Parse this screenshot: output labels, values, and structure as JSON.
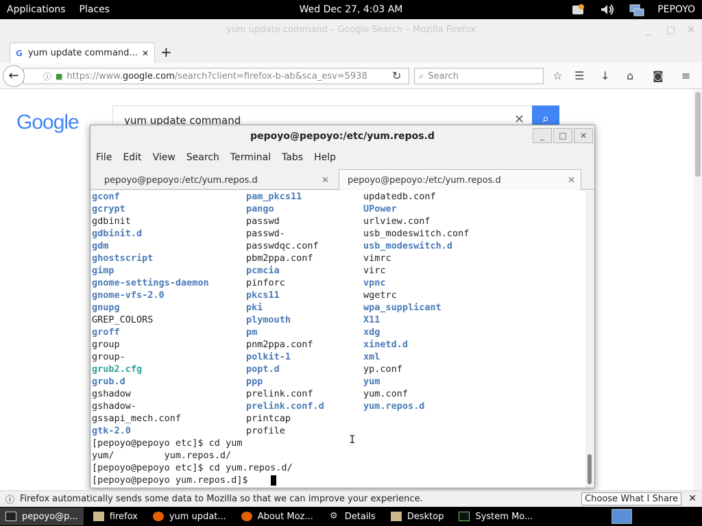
{
  "topbar": {
    "applications": "Applications",
    "places": "Places",
    "clock": "Wed Dec 27,  4:03 AM",
    "user": "PEPOYO"
  },
  "firefox": {
    "window_title": "yum update command – Google Search – Mozilla Firefox",
    "tab_title": "yum update command...",
    "url_prefix": "https://www.",
    "url_domain": "google.com",
    "url_rest": "/search?client=firefox-b-ab&sca_esv=5938",
    "search_placeholder": "Search",
    "notification": "Firefox automatically sends some data to Mozilla so that we can improve your experience.",
    "notification_button": "Choose What I Share"
  },
  "google": {
    "logo": "Google",
    "query": "yum update command"
  },
  "terminal": {
    "title": "pepoyo@pepoyo:/etc/yum.repos.d",
    "menu": [
      "File",
      "Edit",
      "View",
      "Search",
      "Terminal",
      "Tabs",
      "Help"
    ],
    "tabs": [
      "pepoyo@pepoyo:/etc/yum.repos.d",
      "pepoyo@pepoyo:/etc/yum.repos.d"
    ],
    "rows": [
      [
        {
          "t": "gconf",
          "k": "dir"
        },
        {
          "t": "pam_pkcs11",
          "k": "dir"
        },
        {
          "t": "updatedb.conf",
          "k": "file"
        }
      ],
      [
        {
          "t": "gcrypt",
          "k": "dir"
        },
        {
          "t": "pango",
          "k": "dir"
        },
        {
          "t": "UPower",
          "k": "dir"
        }
      ],
      [
        {
          "t": "gdbinit",
          "k": "file"
        },
        {
          "t": "passwd",
          "k": "file"
        },
        {
          "t": "urlview.conf",
          "k": "file"
        }
      ],
      [
        {
          "t": "gdbinit.d",
          "k": "dir"
        },
        {
          "t": "passwd-",
          "k": "file"
        },
        {
          "t": "usb_modeswitch.conf",
          "k": "file"
        }
      ],
      [
        {
          "t": "gdm",
          "k": "dir"
        },
        {
          "t": "passwdqc.conf",
          "k": "file"
        },
        {
          "t": "usb_modeswitch.d",
          "k": "dir"
        }
      ],
      [
        {
          "t": "ghostscript",
          "k": "dir"
        },
        {
          "t": "pbm2ppa.conf",
          "k": "file"
        },
        {
          "t": "vimrc",
          "k": "file"
        }
      ],
      [
        {
          "t": "gimp",
          "k": "dir"
        },
        {
          "t": "pcmcia",
          "k": "dir"
        },
        {
          "t": "virc",
          "k": "file"
        }
      ],
      [
        {
          "t": "gnome-settings-daemon",
          "k": "dir"
        },
        {
          "t": "pinforc",
          "k": "file"
        },
        {
          "t": "vpnc",
          "k": "dir"
        }
      ],
      [
        {
          "t": "gnome-vfs-2.0",
          "k": "dir"
        },
        {
          "t": "pkcs11",
          "k": "dir"
        },
        {
          "t": "wgetrc",
          "k": "file"
        }
      ],
      [
        {
          "t": "gnupg",
          "k": "dir"
        },
        {
          "t": "pki",
          "k": "dir"
        },
        {
          "t": "wpa_supplicant",
          "k": "dir"
        }
      ],
      [
        {
          "t": "GREP_COLORS",
          "k": "file"
        },
        {
          "t": "plymouth",
          "k": "dir"
        },
        {
          "t": "X11",
          "k": "dir"
        }
      ],
      [
        {
          "t": "groff",
          "k": "dir"
        },
        {
          "t": "pm",
          "k": "dir"
        },
        {
          "t": "xdg",
          "k": "dir"
        }
      ],
      [
        {
          "t": "group",
          "k": "file"
        },
        {
          "t": "pnm2ppa.conf",
          "k": "file"
        },
        {
          "t": "xinetd.d",
          "k": "dir"
        }
      ],
      [
        {
          "t": "group-",
          "k": "file"
        },
        {
          "t": "polkit-1",
          "k": "dir"
        },
        {
          "t": "xml",
          "k": "dir"
        }
      ],
      [
        {
          "t": "grub2.cfg",
          "k": "link"
        },
        {
          "t": "popt.d",
          "k": "dir"
        },
        {
          "t": "yp.conf",
          "k": "file"
        }
      ],
      [
        {
          "t": "grub.d",
          "k": "dir"
        },
        {
          "t": "ppp",
          "k": "dir"
        },
        {
          "t": "yum",
          "k": "dir"
        }
      ],
      [
        {
          "t": "gshadow",
          "k": "file"
        },
        {
          "t": "prelink.conf",
          "k": "file"
        },
        {
          "t": "yum.conf",
          "k": "file"
        }
      ],
      [
        {
          "t": "gshadow-",
          "k": "file"
        },
        {
          "t": "prelink.conf.d",
          "k": "dir"
        },
        {
          "t": "yum.repos.d",
          "k": "dir"
        }
      ],
      [
        {
          "t": "gssapi_mech.conf",
          "k": "file"
        },
        {
          "t": "printcap",
          "k": "file"
        },
        {
          "t": "",
          "k": "file"
        }
      ],
      [
        {
          "t": "gtk-2.0",
          "k": "dir"
        },
        {
          "t": "profile",
          "k": "file"
        },
        {
          "t": "",
          "k": "file"
        }
      ]
    ],
    "commands": [
      "[pepoyo@pepoyo etc]$ cd yum",
      "yum/         yum.repos.d/",
      "[pepoyo@pepoyo etc]$ cd yum.repos.d/",
      "[pepoyo@pepoyo yum.repos.d]$ "
    ]
  },
  "taskbar": {
    "items": [
      "pepoyo@p...",
      "firefox",
      "yum updat...",
      "About Moz...",
      "Details",
      "Desktop",
      "System Mo..."
    ]
  }
}
